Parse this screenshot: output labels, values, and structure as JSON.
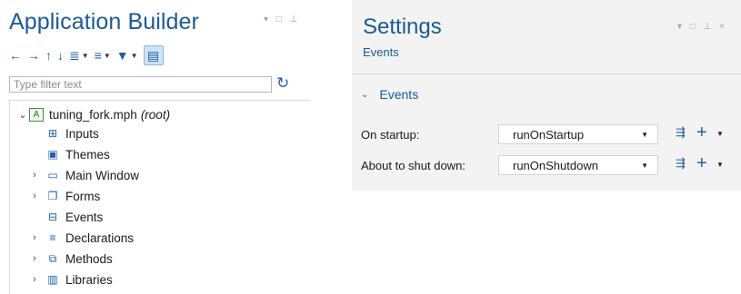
{
  "app_builder": {
    "title": "Application Builder",
    "pane_controls": "▾ □ ⊥",
    "toolbar": [
      {
        "icon": "arrow-left-icon",
        "glyph": "←"
      },
      {
        "icon": "arrow-right-icon",
        "glyph": "→"
      },
      {
        "icon": "arrow-up-icon",
        "glyph": "↑"
      },
      {
        "icon": "arrow-down-icon",
        "glyph": "↓"
      },
      {
        "icon": "list-options-icon",
        "glyph": "≣▾"
      },
      {
        "icon": "list-sort-icon",
        "glyph": "≡▾"
      },
      {
        "icon": "funnel-icon",
        "glyph": "▼▾"
      },
      {
        "icon": "tree-view-icon",
        "glyph": "▤"
      }
    ],
    "filter_placeholder": "Type filter text",
    "tree": {
      "root": {
        "label": "tuning_fork.mph",
        "tag": "(root)",
        "icon_letter": "A"
      },
      "items": [
        {
          "label": "Inputs",
          "icon": "inputs-icon",
          "expandable": false
        },
        {
          "label": "Themes",
          "icon": "themes-icon",
          "expandable": false
        },
        {
          "label": "Main Window",
          "icon": "window-icon",
          "expandable": true
        },
        {
          "label": "Forms",
          "icon": "forms-icon",
          "expandable": true
        },
        {
          "label": "Events",
          "icon": "events-icon",
          "expandable": false
        },
        {
          "label": "Declarations",
          "icon": "declarations-icon",
          "expandable": true
        },
        {
          "label": "Methods",
          "icon": "methods-icon",
          "expandable": true
        },
        {
          "label": "Libraries",
          "icon": "libraries-icon",
          "expandable": true
        }
      ]
    }
  },
  "settings": {
    "title": "Settings",
    "subtitle": "Events",
    "pane_controls": "▾ □ ⊥ ×",
    "section_title": "Events",
    "rows": [
      {
        "label": "On startup:",
        "value": "runOnStartup"
      },
      {
        "label": "About to shut down:",
        "value": "runOnShutdown"
      }
    ]
  }
}
